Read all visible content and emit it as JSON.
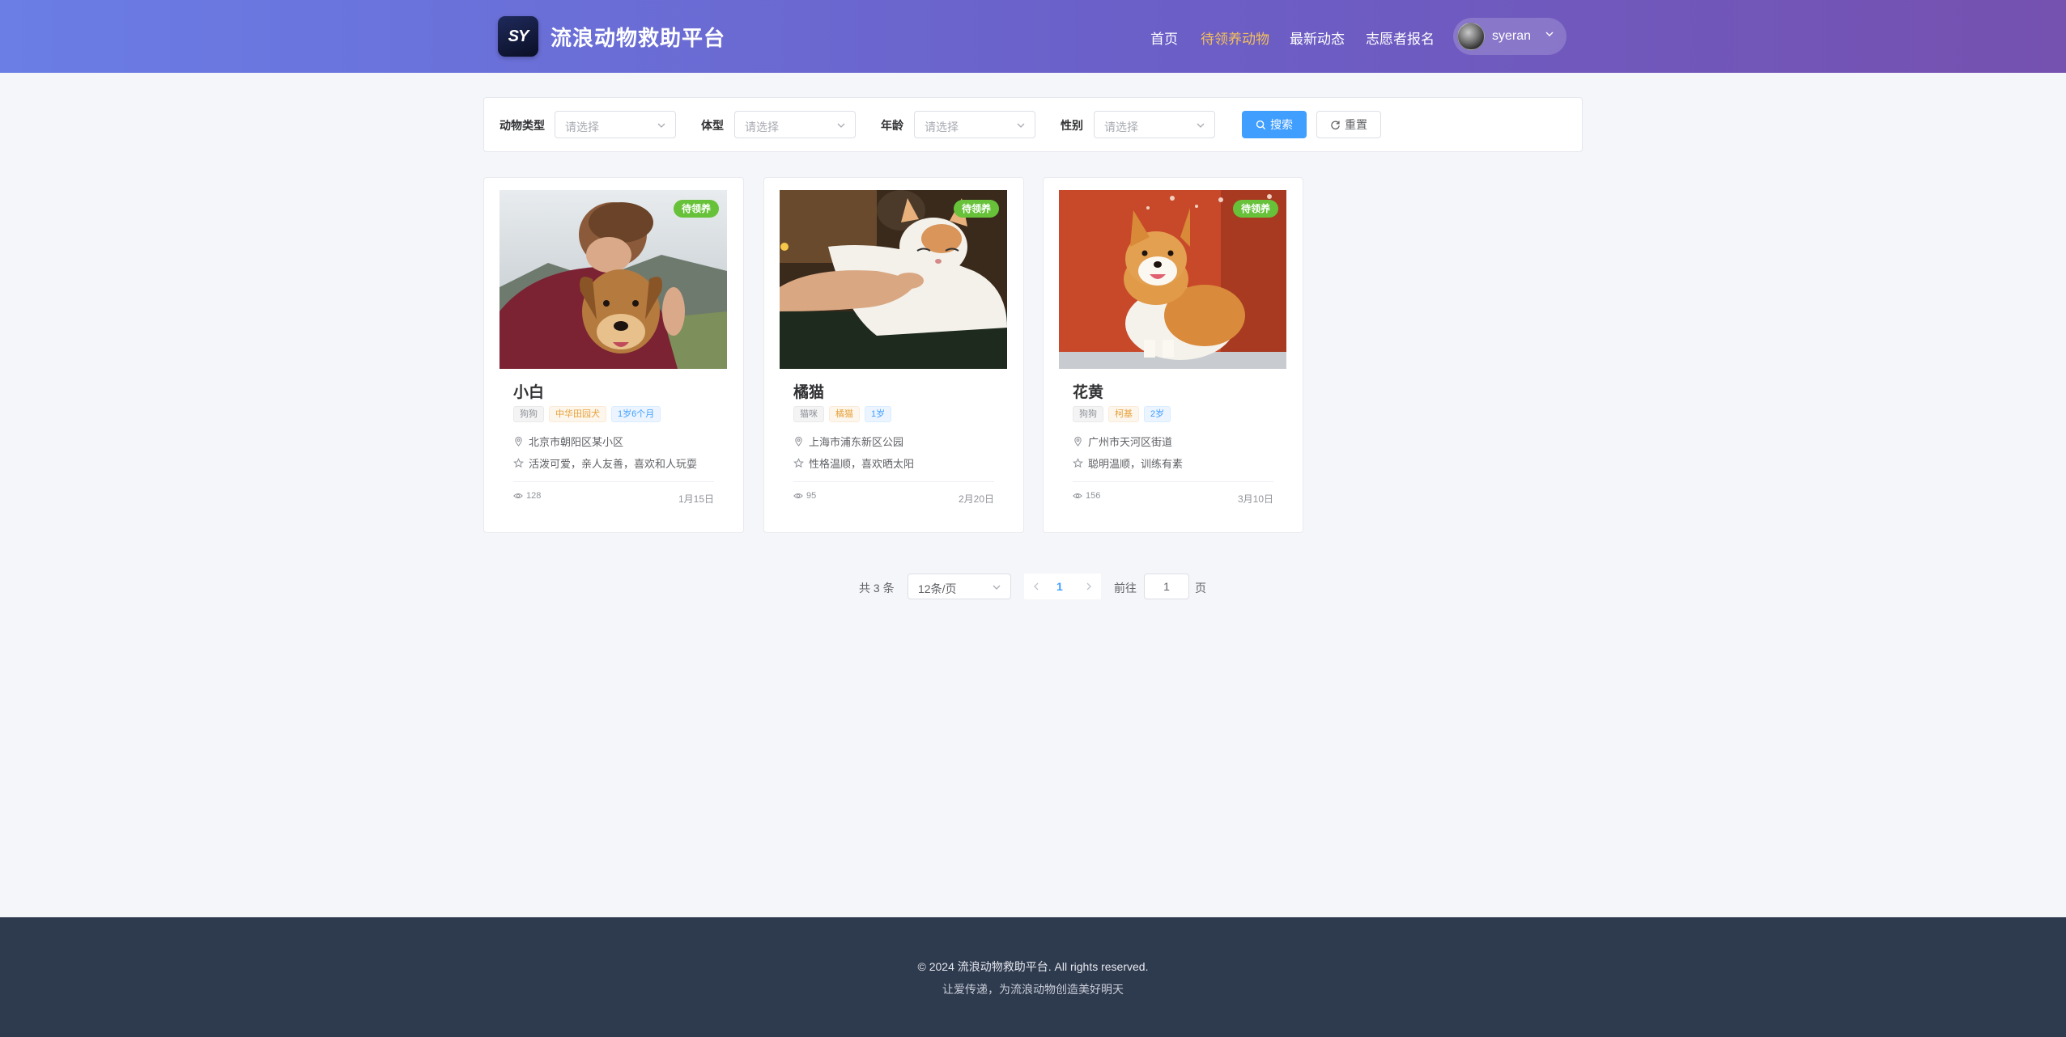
{
  "header": {
    "logo_text": "SY",
    "site_title": "流浪动物救助平台",
    "nav": [
      "首页",
      "待领养动物",
      "最新动态",
      "志愿者报名"
    ],
    "active_nav": "待领养动物",
    "username": "syeran"
  },
  "filters": [
    {
      "label": "动物类型",
      "placeholder": "请选择"
    },
    {
      "label": "体型",
      "placeholder": "请选择"
    },
    {
      "label": "年龄",
      "placeholder": "请选择"
    },
    {
      "label": "性别",
      "placeholder": "请选择"
    }
  ],
  "buttons": {
    "search": "搜索",
    "reset": "重置"
  },
  "animals": [
    {
      "name": "小白",
      "status": "待领养",
      "tags": [
        "狗狗",
        "中华田园犬",
        "1岁6个月"
      ],
      "location": "北京市朝阳区某小区",
      "description": "活泼可爱，亲人友善，喜欢和人玩耍",
      "views": "128",
      "date": "1月15日"
    },
    {
      "name": "橘猫",
      "status": "待领养",
      "tags": [
        "猫咪",
        "橘猫",
        "1岁"
      ],
      "location": "上海市浦东新区公园",
      "description": "性格温顺，喜欢晒太阳",
      "views": "95",
      "date": "2月20日"
    },
    {
      "name": "花黄",
      "status": "待领养",
      "tags": [
        "狗狗",
        "柯基",
        "2岁"
      ],
      "location": "广州市天河区街道",
      "description": "聪明温顺，训练有素",
      "views": "156",
      "date": "3月10日"
    }
  ],
  "pagination": {
    "total": "共 3 条",
    "page_size": "12条/页",
    "current_page": "1",
    "goto_label": "前往",
    "goto_value": "1",
    "goto_unit": "页"
  },
  "footer": {
    "copyright": "© 2024 流浪动物救助平台. All rights reserved.",
    "slogan": "让爱传递，为流浪动物创造美好明天"
  },
  "colors": {
    "header_gradient_start": "#6a7ee6",
    "header_gradient_end": "#7551b0",
    "active_nav": "#f5c05a",
    "primary": "#409eff",
    "status_green": "#67c23a",
    "footer_bg": "#2e3a4e"
  }
}
